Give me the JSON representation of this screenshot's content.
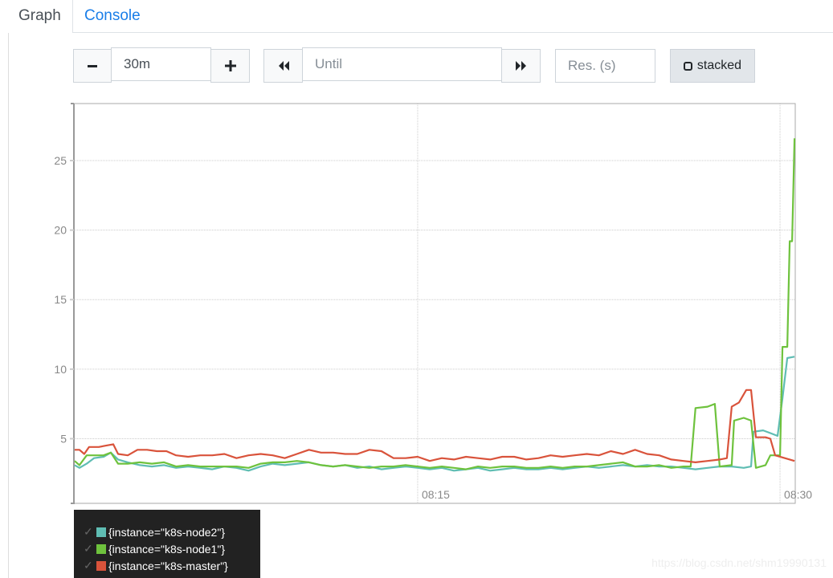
{
  "tabs": [
    {
      "label": "Graph",
      "active": true
    },
    {
      "label": "Console",
      "active": false
    }
  ],
  "controls": {
    "range_minus_icon": "minus-icon",
    "range_value": "30m",
    "range_plus_icon": "plus-icon",
    "back_icon": "fast-backward-icon",
    "until_placeholder": "Until",
    "forward_icon": "fast-forward-icon",
    "resolution_placeholder": "Res. (s)",
    "stacked_label": "stacked"
  },
  "legend": [
    {
      "label": "{instance=\"k8s-node2\"}",
      "color": "#5fbdb3",
      "checked": true
    },
    {
      "label": "{instance=\"k8s-node1\"}",
      "color": "#6ec23d",
      "checked": true
    },
    {
      "label": "{instance=\"k8s-master\"}",
      "color": "#d9533b",
      "checked": true
    }
  ],
  "watermark": "https://blog.csdn.net/shm19990131",
  "chart_data": {
    "type": "line",
    "title": "",
    "xlabel": "",
    "ylabel": "",
    "x_unit": "minutes after 08:00",
    "xlim": [
      0.77,
      30.63
    ],
    "ylim": [
      0.35,
      29.1
    ],
    "x_ticks": [
      {
        "value": 15,
        "label": "08:15"
      },
      {
        "value": 30,
        "label": "08:30"
      }
    ],
    "y_ticks": [
      5,
      10,
      15,
      20,
      25
    ],
    "grid": true,
    "legend_position": "bottom-left",
    "series": [
      {
        "name": "{instance=\"k8s-node2\"}",
        "color": "#5fbdb3",
        "points": [
          [
            0.8,
            3.1
          ],
          [
            1.0,
            2.9
          ],
          [
            1.3,
            3.2
          ],
          [
            1.6,
            3.6
          ],
          [
            2.0,
            3.7
          ],
          [
            2.3,
            4.0
          ],
          [
            2.6,
            3.5
          ],
          [
            3.0,
            3.3
          ],
          [
            3.5,
            3.1
          ],
          [
            4.0,
            3.0
          ],
          [
            4.5,
            3.1
          ],
          [
            5.0,
            2.9
          ],
          [
            5.5,
            3.0
          ],
          [
            6.0,
            2.9
          ],
          [
            6.5,
            2.8
          ],
          [
            7.0,
            3.0
          ],
          [
            7.5,
            2.9
          ],
          [
            8.0,
            2.7
          ],
          [
            8.5,
            3.0
          ],
          [
            9.0,
            3.2
          ],
          [
            9.5,
            3.1
          ],
          [
            10.0,
            3.2
          ],
          [
            10.5,
            3.3
          ],
          [
            11.0,
            3.1
          ],
          [
            11.5,
            3.0
          ],
          [
            12.0,
            3.1
          ],
          [
            12.5,
            2.9
          ],
          [
            13.0,
            3.0
          ],
          [
            13.5,
            2.8
          ],
          [
            14.0,
            2.9
          ],
          [
            14.5,
            3.0
          ],
          [
            15.0,
            2.9
          ],
          [
            15.5,
            2.8
          ],
          [
            16.0,
            2.9
          ],
          [
            16.5,
            2.7
          ],
          [
            17.0,
            2.8
          ],
          [
            17.5,
            2.9
          ],
          [
            18.0,
            2.7
          ],
          [
            18.5,
            2.8
          ],
          [
            19.0,
            2.9
          ],
          [
            19.5,
            2.8
          ],
          [
            20.0,
            2.8
          ],
          [
            20.5,
            2.9
          ],
          [
            21.0,
            2.8
          ],
          [
            21.5,
            2.9
          ],
          [
            22.0,
            3.0
          ],
          [
            22.5,
            2.9
          ],
          [
            23.0,
            3.0
          ],
          [
            23.5,
            3.1
          ],
          [
            24.0,
            3.0
          ],
          [
            24.5,
            3.1
          ],
          [
            25.0,
            3.0
          ],
          [
            25.5,
            3.0
          ],
          [
            26.0,
            2.9
          ],
          [
            26.5,
            2.8
          ],
          [
            27.0,
            2.9
          ],
          [
            27.5,
            3.0
          ],
          [
            28.0,
            3.0
          ],
          [
            28.5,
            2.9
          ],
          [
            28.8,
            3.0
          ],
          [
            28.9,
            5.5
          ],
          [
            29.3,
            5.6
          ],
          [
            29.6,
            5.4
          ],
          [
            29.9,
            5.2
          ],
          [
            30.1,
            7.9
          ],
          [
            30.3,
            10.8
          ],
          [
            30.6,
            10.9
          ]
        ]
      },
      {
        "name": "{instance=\"k8s-node1\"}",
        "color": "#6ec23d",
        "points": [
          [
            0.8,
            3.4
          ],
          [
            1.0,
            3.1
          ],
          [
            1.3,
            3.8
          ],
          [
            1.6,
            3.8
          ],
          [
            2.0,
            3.8
          ],
          [
            2.3,
            4.0
          ],
          [
            2.6,
            3.2
          ],
          [
            3.0,
            3.2
          ],
          [
            3.5,
            3.3
          ],
          [
            4.0,
            3.2
          ],
          [
            4.5,
            3.3
          ],
          [
            5.0,
            3.0
          ],
          [
            5.5,
            3.1
          ],
          [
            6.0,
            3.0
          ],
          [
            6.5,
            3.0
          ],
          [
            7.0,
            3.0
          ],
          [
            7.5,
            3.0
          ],
          [
            8.0,
            2.9
          ],
          [
            8.5,
            3.2
          ],
          [
            9.0,
            3.3
          ],
          [
            9.5,
            3.3
          ],
          [
            10.0,
            3.4
          ],
          [
            10.5,
            3.3
          ],
          [
            11.0,
            3.1
          ],
          [
            11.5,
            3.0
          ],
          [
            12.0,
            3.1
          ],
          [
            12.5,
            3.0
          ],
          [
            13.0,
            2.9
          ],
          [
            13.5,
            3.0
          ],
          [
            14.0,
            3.0
          ],
          [
            14.5,
            3.1
          ],
          [
            15.0,
            3.0
          ],
          [
            15.5,
            2.9
          ],
          [
            16.0,
            3.0
          ],
          [
            16.5,
            2.9
          ],
          [
            17.0,
            2.8
          ],
          [
            17.5,
            3.0
          ],
          [
            18.0,
            2.9
          ],
          [
            18.5,
            3.0
          ],
          [
            19.0,
            3.0
          ],
          [
            19.5,
            2.9
          ],
          [
            20.0,
            2.9
          ],
          [
            20.5,
            3.0
          ],
          [
            21.0,
            2.9
          ],
          [
            21.5,
            3.0
          ],
          [
            22.0,
            3.0
          ],
          [
            22.5,
            3.1
          ],
          [
            23.0,
            3.2
          ],
          [
            23.5,
            3.3
          ],
          [
            24.0,
            3.0
          ],
          [
            24.5,
            3.0
          ],
          [
            25.0,
            3.1
          ],
          [
            25.5,
            2.9
          ],
          [
            26.0,
            3.0
          ],
          [
            26.3,
            3.0
          ],
          [
            26.5,
            7.2
          ],
          [
            27.0,
            7.3
          ],
          [
            27.3,
            7.5
          ],
          [
            27.5,
            3.0
          ],
          [
            28.0,
            3.1
          ],
          [
            28.1,
            6.3
          ],
          [
            28.5,
            6.5
          ],
          [
            28.8,
            6.3
          ],
          [
            29.0,
            2.9
          ],
          [
            29.4,
            3.1
          ],
          [
            29.6,
            3.8
          ],
          [
            30.0,
            3.8
          ],
          [
            30.1,
            11.6
          ],
          [
            30.3,
            11.6
          ],
          [
            30.4,
            19.2
          ],
          [
            30.5,
            19.2
          ],
          [
            30.6,
            26.6
          ]
        ]
      },
      {
        "name": "{instance=\"k8s-master\"}",
        "color": "#d9533b",
        "points": [
          [
            0.8,
            4.2
          ],
          [
            1.0,
            4.2
          ],
          [
            1.2,
            3.9
          ],
          [
            1.4,
            4.4
          ],
          [
            1.8,
            4.4
          ],
          [
            2.1,
            4.5
          ],
          [
            2.4,
            4.6
          ],
          [
            2.6,
            3.9
          ],
          [
            3.0,
            3.8
          ],
          [
            3.4,
            4.2
          ],
          [
            3.8,
            4.2
          ],
          [
            4.2,
            4.1
          ],
          [
            4.6,
            4.1
          ],
          [
            5.0,
            3.8
          ],
          [
            5.5,
            3.7
          ],
          [
            6.0,
            3.8
          ],
          [
            6.5,
            3.8
          ],
          [
            7.0,
            3.9
          ],
          [
            7.5,
            3.6
          ],
          [
            8.0,
            3.8
          ],
          [
            8.5,
            3.9
          ],
          [
            9.0,
            3.8
          ],
          [
            9.5,
            3.6
          ],
          [
            10.0,
            3.9
          ],
          [
            10.5,
            4.2
          ],
          [
            11.0,
            4.0
          ],
          [
            11.5,
            4.0
          ],
          [
            12.0,
            3.9
          ],
          [
            12.5,
            3.9
          ],
          [
            13.0,
            4.2
          ],
          [
            13.5,
            4.1
          ],
          [
            14.0,
            3.6
          ],
          [
            14.5,
            3.6
          ],
          [
            15.0,
            3.7
          ],
          [
            15.5,
            3.4
          ],
          [
            16.0,
            3.6
          ],
          [
            16.5,
            3.5
          ],
          [
            17.0,
            3.7
          ],
          [
            17.5,
            3.6
          ],
          [
            18.0,
            3.5
          ],
          [
            18.5,
            3.7
          ],
          [
            19.0,
            3.7
          ],
          [
            19.5,
            3.5
          ],
          [
            20.0,
            3.6
          ],
          [
            20.5,
            3.8
          ],
          [
            21.0,
            3.7
          ],
          [
            21.5,
            3.8
          ],
          [
            22.0,
            3.9
          ],
          [
            22.5,
            3.8
          ],
          [
            23.0,
            4.1
          ],
          [
            23.5,
            3.9
          ],
          [
            24.0,
            4.2
          ],
          [
            24.5,
            3.9
          ],
          [
            25.0,
            3.8
          ],
          [
            25.5,
            3.5
          ],
          [
            26.0,
            3.4
          ],
          [
            26.5,
            3.3
          ],
          [
            27.0,
            3.4
          ],
          [
            27.5,
            3.5
          ],
          [
            27.8,
            3.6
          ],
          [
            28.0,
            7.3
          ],
          [
            28.3,
            7.6
          ],
          [
            28.6,
            8.5
          ],
          [
            28.8,
            8.5
          ],
          [
            29.0,
            5.1
          ],
          [
            29.4,
            5.1
          ],
          [
            29.6,
            5.0
          ],
          [
            29.8,
            3.8
          ],
          [
            30.2,
            3.6
          ],
          [
            30.6,
            3.4
          ]
        ]
      }
    ]
  }
}
